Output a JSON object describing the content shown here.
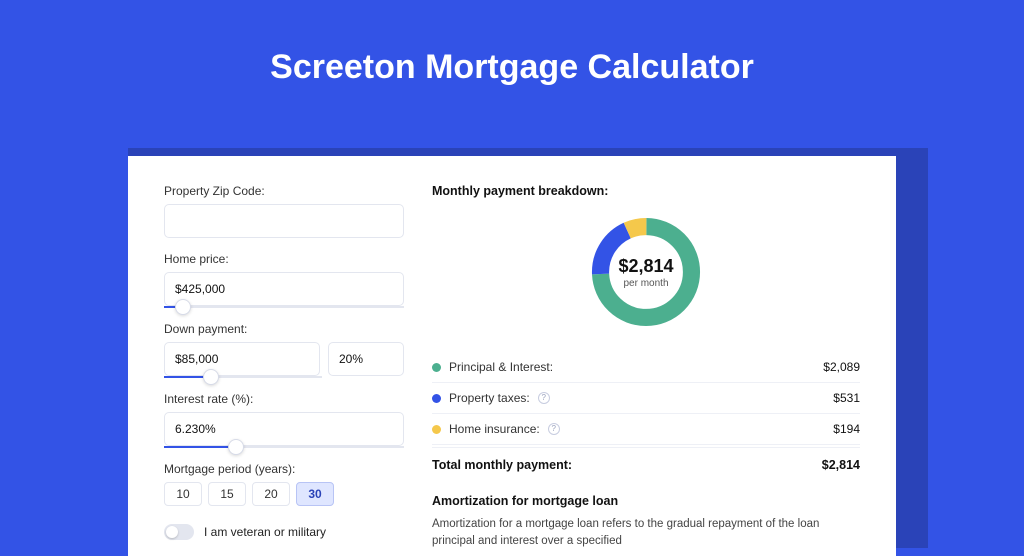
{
  "title": "Screeton Mortgage Calculator",
  "form": {
    "zip": {
      "label": "Property Zip Code:",
      "value": ""
    },
    "home_price": {
      "label": "Home price:",
      "value": "$425,000",
      "slider_pct": 8
    },
    "down_payment": {
      "label": "Down payment:",
      "amount": "$85,000",
      "pct": "20%",
      "slider_pct": 20
    },
    "interest_rate": {
      "label": "Interest rate (%):",
      "value": "6.230%",
      "slider_pct": 30
    },
    "period": {
      "label": "Mortgage period (years):",
      "options": [
        "10",
        "15",
        "20",
        "30"
      ],
      "selected": "30"
    },
    "veteran": {
      "label": "I am veteran or military",
      "enabled": false
    }
  },
  "breakdown": {
    "title": "Monthly payment breakdown:",
    "center_amount": "$2,814",
    "center_sub": "per month",
    "items": [
      {
        "label": "Principal & Interest:",
        "value": "$2,089",
        "color": "green",
        "info": false
      },
      {
        "label": "Property taxes:",
        "value": "$531",
        "color": "blue",
        "info": true
      },
      {
        "label": "Home insurance:",
        "value": "$194",
        "color": "yellow",
        "info": true
      }
    ],
    "total_label": "Total monthly payment:",
    "total_value": "$2,814"
  },
  "amortization": {
    "title": "Amortization for mortgage loan",
    "text": "Amortization for a mortgage loan refers to the gradual repayment of the loan principal and interest over a specified"
  },
  "chart_data": {
    "type": "pie",
    "title": "Monthly payment breakdown",
    "series": [
      {
        "name": "Principal & Interest",
        "value": 2089,
        "color": "#4caf8f"
      },
      {
        "name": "Property taxes",
        "value": 531,
        "color": "#3353e6"
      },
      {
        "name": "Home insurance",
        "value": 194,
        "color": "#f5c84b"
      }
    ],
    "total": 2814,
    "center_label": "$2,814 per month"
  }
}
